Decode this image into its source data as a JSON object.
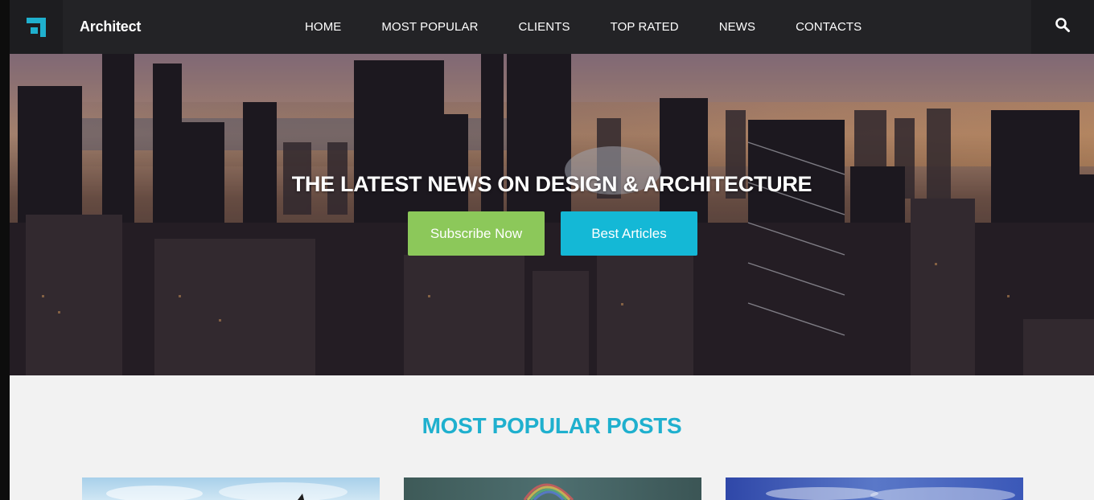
{
  "brand": {
    "name": "Architect",
    "logo_icon": "architect-logo-icon",
    "accent": "#1fb0ce"
  },
  "nav": {
    "items": [
      {
        "label": "HOME"
      },
      {
        "label": "MOST POPULAR"
      },
      {
        "label": "CLIENTS"
      },
      {
        "label": "TOP RATED"
      },
      {
        "label": "NEWS"
      },
      {
        "label": "CONTACTS"
      }
    ],
    "search_icon": "search-icon"
  },
  "hero": {
    "title": "THE LATEST NEWS ON DESIGN & ARCHITECTURE",
    "subscribe_label": "Subscribe Now",
    "subscribe_color": "#8cc85a",
    "best_label": "Best Articles",
    "best_color": "#14b8d6"
  },
  "popular": {
    "title": "MOST POPULAR POSTS"
  }
}
